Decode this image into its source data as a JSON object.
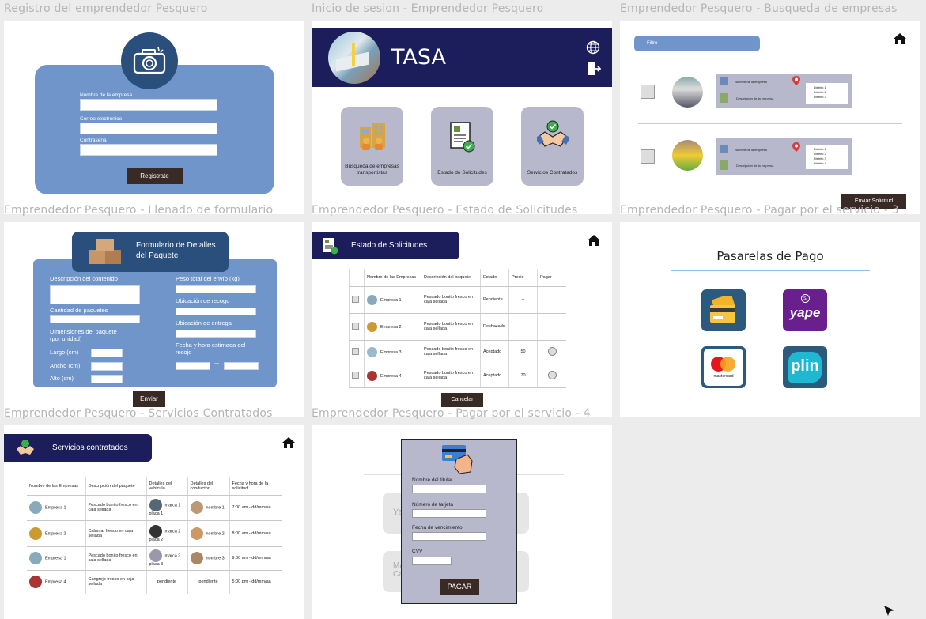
{
  "frames": {
    "registro": {
      "label": "Registro del emprendedor Pesquero",
      "fields": [
        "Nombre de la empresa",
        "Correo electrónico",
        "Contraseña"
      ],
      "button": "Registrate",
      "icon": "camera-icon"
    },
    "login": {
      "label": "Inicio de sesion - Emprendedor Pesquero",
      "brand": "TASA",
      "cards": [
        {
          "label": "Búsqueda de empresas transportistas",
          "icon": "buildings-icon"
        },
        {
          "label": "Estado de Solicitudes",
          "icon": "document-check-icon"
        },
        {
          "label": "Servicios Contratados",
          "icon": "handshake-icon"
        }
      ]
    },
    "busqueda": {
      "label": "Emprendedor Pesquero - Busqueda de empresas",
      "filter_label": "Filtro",
      "results": [
        {
          "name_label": "Nombre de la empresa",
          "desc_label": "Descripción de la empresa",
          "districts": [
            "Distrito 1",
            "Distrito 2",
            "Distrito 3"
          ]
        },
        {
          "name_label": "Nombre de la empresa",
          "desc_label": "Descripción de la empresa",
          "districts": [
            "Distrito 1",
            "Distrito 2",
            "Distrito 3",
            "Distrito 4"
          ]
        }
      ],
      "send_button": "Enviar Solicitud"
    },
    "formulario": {
      "label": "Emprendedor Pesquero - Llenado de formulario",
      "title": "Formulario de Detalles del Paquete",
      "left_fields": [
        "Descripción del contenido",
        "Cantidad de paquetes",
        "Dimensiones del paquete (por unidad)"
      ],
      "dims": [
        "Largo (cm)",
        "Ancho (cm)",
        "Alto (cm)"
      ],
      "right_fields": [
        "Peso total del envío (kg)",
        "Ubicación de recogo",
        "Ubicación de entrega",
        "Fecha y hora estimada del recojo"
      ],
      "date_separator": "—",
      "button": "Enviar"
    },
    "estado": {
      "label": "Emprendedor Pesquero - Estado de Solicitudes",
      "title": "Estado de Solicitudes",
      "headers": [
        "",
        "Nombre de las Empresas",
        "Descripción del paquete",
        "Estado",
        "Precio",
        "Pagar"
      ],
      "rows": [
        {
          "name": "Empresa 1",
          "desc": "Pescado bonito fresco en caja sellada",
          "status": "Pendiente",
          "price": "--",
          "pay": false
        },
        {
          "name": "Empresa 2",
          "desc": "Pescado bonito fresco en caja sellada",
          "status": "Rechazado",
          "price": "--",
          "pay": false
        },
        {
          "name": "Empresa 3",
          "desc": "Pescado bonito fresco en caja sellada",
          "status": "Aceptado",
          "price": "50",
          "pay": true
        },
        {
          "name": "Empresa 4",
          "desc": "Pescado bonito fresco en caja sellada",
          "status": "Aceptado",
          "price": "70",
          "pay": true
        }
      ],
      "cancel_button": "Cancelar"
    },
    "pasarelas": {
      "label": "Emprendedor Pesquero - Pagar por el servicio - 3",
      "title": "Pasarelas de Pago",
      "options": [
        {
          "name": "card-payment",
          "text": ""
        },
        {
          "name": "yape",
          "text": "yape",
          "badge": "S/"
        },
        {
          "name": "mastercard",
          "text": "mastercard"
        },
        {
          "name": "plin",
          "text": "plin"
        }
      ]
    },
    "servicios": {
      "label": "Emprendedor Pesquero - Servicios Contratados",
      "title": "Servicios contratados",
      "headers": [
        "Nombre de las Empresas",
        "Descripción del paquete",
        "Detalles del vehiculo",
        "Detalles del conductor",
        "Fecha y hora de la solicitud"
      ],
      "rows": [
        {
          "name": "Empresa 1",
          "desc": "Pescado bonito fresco en caja sellada",
          "vehicle": "marca 1 placa 1",
          "driver": "nombre 1",
          "time": "7:00 am - dd/mm/aa"
        },
        {
          "name": "Empresa 2",
          "desc": "Calamar fresco en caja sellada",
          "vehicle": "marca 2 placa 2",
          "driver": "nombre 2",
          "time": "8:00 am - dd/mm/aa"
        },
        {
          "name": "Empresa 1",
          "desc": "Pescado bonito fresco en caja sellada",
          "vehicle": "marca 3 placa 3",
          "driver": "nombre 3",
          "time": "9:00 am - dd/mm/aa"
        },
        {
          "name": "Empresa 4",
          "desc": "Cangrejo fresco en caja sellada",
          "vehicle": "pendiente",
          "driver": "pendiente",
          "time": "5:00 pm - dd/mm/aa"
        }
      ]
    },
    "pago4": {
      "label": "Emprendedor Pesquero - Pagar por el servicio - 4",
      "fields": [
        "Nombre del titular",
        "Número de tarjeta",
        "Fecha de vencimiento",
        "CVV"
      ],
      "button": "PAGAR",
      "bg_fragments": [
        "Ya",
        "Ma",
        "Ca"
      ]
    }
  },
  "colors": {
    "navy": "#1b1e5a",
    "blue": "#6f95cb",
    "dark_button": "#3a2a26",
    "card_gray": "#b8b8cc"
  }
}
